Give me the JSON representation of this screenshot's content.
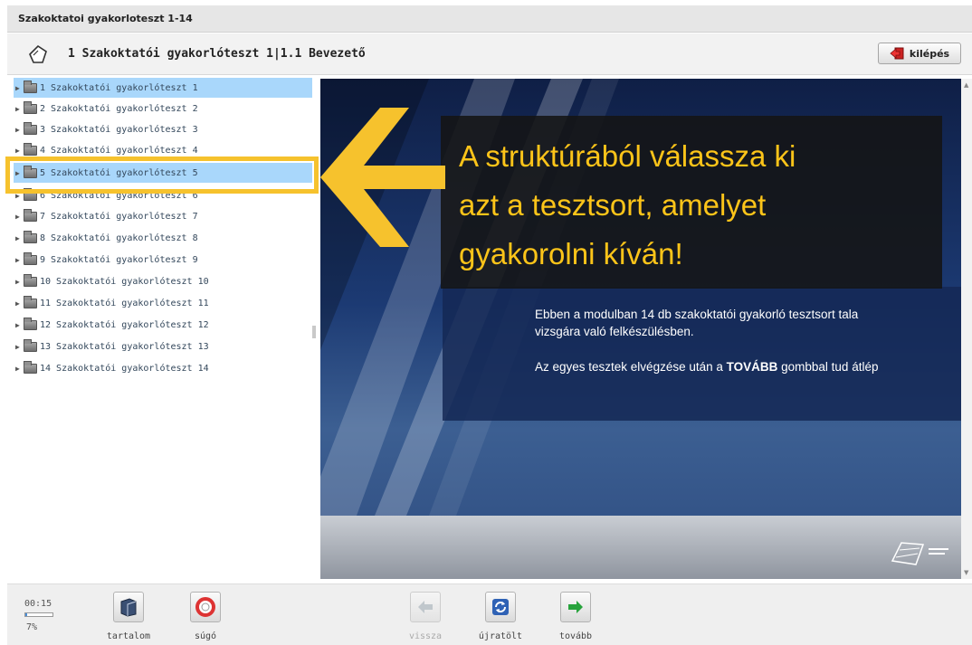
{
  "window": {
    "title": "Szakoktatoi gyakorloteszt 1-14"
  },
  "header": {
    "breadcrumb": "1 Szakoktatói gyakorlóteszt 1|1.1 Bevezető",
    "exit_label": "kilépés"
  },
  "tree": {
    "items": [
      {
        "label": "1 Szakoktatói gyakorlóteszt 1",
        "selected": true
      },
      {
        "label": "2 Szakoktatói gyakorlóteszt 2"
      },
      {
        "label": "3 Szakoktatói gyakorlóteszt 3"
      },
      {
        "label": "4 Szakoktatói gyakorlóteszt 4"
      },
      {
        "label": "5 Szakoktatói gyakorlóteszt 5",
        "selected": true
      },
      {
        "label": "6 Szakoktatói gyakorlóteszt 6"
      },
      {
        "label": "7 Szakoktatói gyakorlóteszt 7"
      },
      {
        "label": "8 Szakoktatói gyakorlóteszt 8"
      },
      {
        "label": "9 Szakoktatói gyakorlóteszt 9"
      },
      {
        "label": "10 Szakoktatói gyakorlóteszt 10"
      },
      {
        "label": "11 Szakoktatói gyakorlóteszt 11"
      },
      {
        "label": "12 Szakoktatói gyakorlóteszt 12"
      },
      {
        "label": "13 Szakoktatói gyakorlóteszt 13"
      },
      {
        "label": "14 Szakoktatói gyakorlóteszt 14"
      }
    ]
  },
  "callout": {
    "lines": [
      "A struktúrából válassza ki",
      "azt a tesztsort, amelyet",
      "gyakorolni kíván!"
    ]
  },
  "intro": {
    "line1": "Ebben a modulban 14 db szakoktatói gyakorló tesztsort tala",
    "line2": "vizsgára való felkészülésben.",
    "line3_prefix": "Az egyes tesztek elvégzése után a ",
    "line3_bold": "TOVÁBB",
    "line3_suffix": " gombbal tud átlép"
  },
  "footer": {
    "time": "00:15",
    "progress_percent": 7,
    "percent_label": "7%",
    "contents_label": "tartalom",
    "help_label": "súgó",
    "back_label": "vissza",
    "reload_label": "újratölt",
    "next_label": "tovább"
  },
  "colors": {
    "highlight": "#f6c22d",
    "callout_text": "#fcc419",
    "selected_row": "#a9d7fb"
  }
}
